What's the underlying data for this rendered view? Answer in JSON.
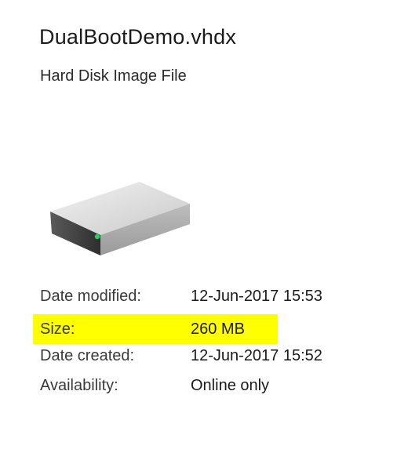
{
  "file": {
    "name": "DualBootDemo.vhdx",
    "type": "Hard Disk Image File",
    "icon": "hard-drive-icon"
  },
  "details": {
    "date_modified_label": "Date modified:",
    "date_modified_value": "12-Jun-2017 15:53",
    "size_label": "Size:",
    "size_value": "260 MB",
    "date_created_label": "Date created:",
    "date_created_value": "12-Jun-2017 15:52",
    "availability_label": "Availability:",
    "availability_value": "Online only"
  },
  "colors": {
    "highlight": "#ffff00",
    "drive_led": "#1ed35a"
  }
}
